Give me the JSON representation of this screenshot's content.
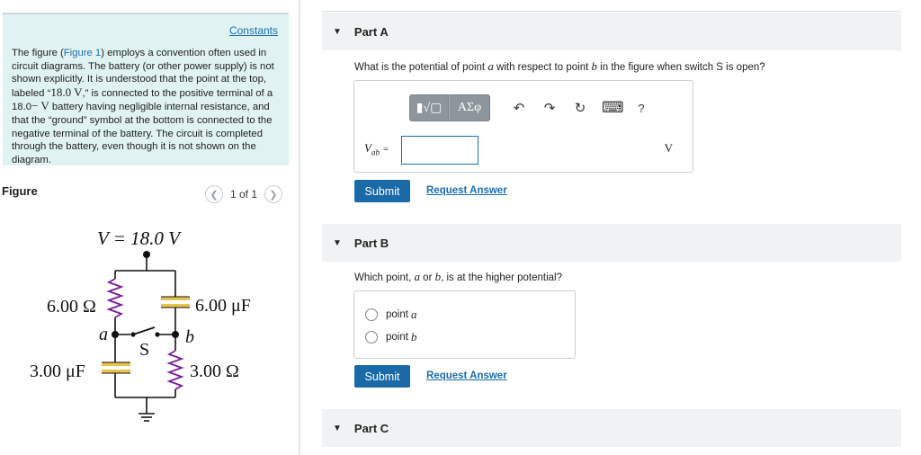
{
  "left_panel": {
    "constants_link": "Constants",
    "intro_pre": "The figure (",
    "intro_link": "Figure 1",
    "intro_post": ") employs a convention often used in circuit diagrams. The battery (or other power supply) is not shown explicitly. It is understood that the point at the top, labeled “",
    "label_value": "18.0 V",
    "intro_post2": ",” is connected to the positive terminal of a 18.0",
    "battery_unit": "− V",
    "intro_post3": " battery having negligible internal resistance, and that the “ground” symbol at the bottom is connected to the negative terminal of the battery. The circuit is completed through the battery, even though it is not shown on the diagram."
  },
  "figure": {
    "label": "Figure",
    "pager_count": "1 of 1",
    "prev_icon": "chevron-left-icon",
    "next_icon": "chevron-right-icon",
    "voltage_label": "V = 18.0 V",
    "r_top_left": "6.00 Ω",
    "c_top_right": "6.00 μF",
    "c_bottom_left": "3.00 μF",
    "r_bottom_right": "3.00 Ω",
    "point_a": "a",
    "point_b": "b",
    "switch_label": "S"
  },
  "part_a": {
    "title": "Part A",
    "question_pre": "What is the potential of point ",
    "var_a": "a",
    "question_mid": " with respect to point ",
    "var_b": "b",
    "question_post": " in the figure when switch S is open?",
    "toolbar": {
      "template_btn": "▮√▢",
      "greek_btn": "ΑΣφ",
      "undo_icon": "↶",
      "redo_icon": "↷",
      "reset_icon": "↻",
      "keyboard_icon": "⌨",
      "help_icon": "?"
    },
    "var_label": "V",
    "var_sub": "ab",
    "eq": "=",
    "input_value": "",
    "unit": "V",
    "submit": "Submit",
    "request": "Request Answer"
  },
  "part_b": {
    "title": "Part B",
    "question_pre": "Which point, ",
    "var_a": "a",
    "question_mid": " or ",
    "var_b": "b",
    "question_post": ", is at the higher potential?",
    "choice_prefix": "point",
    "choice_a": "a",
    "choice_b": "b",
    "submit": "Submit",
    "request": "Request Answer"
  },
  "part_c": {
    "title": "Part C"
  },
  "colors": {
    "accent": "#1a6aa8",
    "link": "#1a6db3",
    "info_bg": "#e0f2f1",
    "capacitor_plate": "#e8c44a",
    "resistor": "#7a1f9c"
  }
}
